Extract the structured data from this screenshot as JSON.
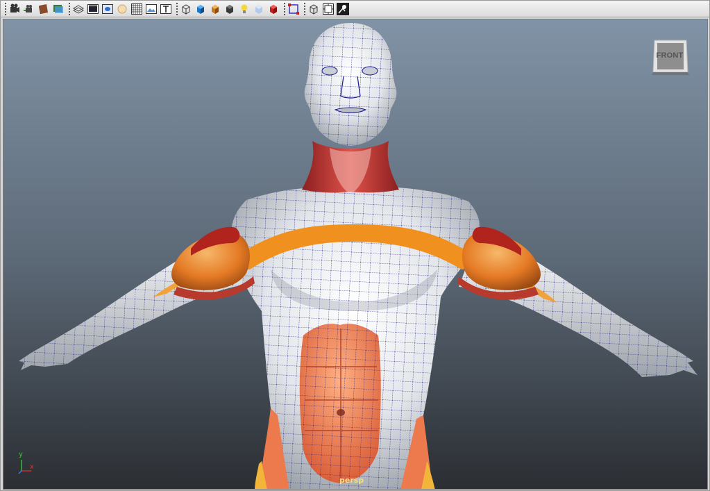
{
  "toolbar": {
    "groups": [
      [
        "select-camera-icon",
        "camera-attributes-icon",
        "bookmark-icon",
        "image-plane-icon"
      ],
      [
        "grid-icon",
        "film-gate-icon",
        "resolution-gate-icon",
        "field-chart-icon",
        "safe-action-icon",
        "safe-title-icon",
        "texture-icon"
      ],
      [
        "wireframe-icon",
        "smooth-shade-icon",
        "textured-icon",
        "shadows-icon",
        "lighting-icon",
        "xray-icon",
        "isolate-icon"
      ],
      [
        "frame-all-icon",
        "frame-selection-icon",
        "toggle-hud-icon",
        "snapshot-icon"
      ]
    ]
  },
  "viewport": {
    "view_cube_label": "FRONT",
    "camera_label": "persp",
    "axis": {
      "y_label": "y",
      "x_label": "x"
    }
  },
  "colors": {
    "bg_top": "#8193a6",
    "bg_bottom": "#2b2e33",
    "wire": "#1a1a8c",
    "muscle_red": "#c8332d",
    "muscle_orange": "#f08a25",
    "muscle_salmon": "#ee7d55",
    "muscle_yellow": "#f2b53a"
  }
}
